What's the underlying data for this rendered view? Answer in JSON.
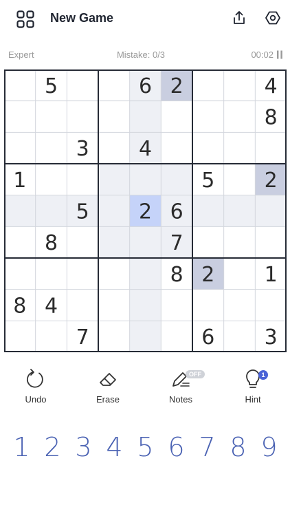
{
  "header": {
    "title": "New Game"
  },
  "status": {
    "difficulty": "Expert",
    "mistakes": "Mistake: 0/3",
    "timer": "00:02"
  },
  "board": {
    "cells": [
      [
        0,
        5,
        0,
        0,
        6,
        2,
        0,
        0,
        4
      ],
      [
        0,
        0,
        0,
        0,
        0,
        0,
        0,
        0,
        8
      ],
      [
        0,
        0,
        3,
        0,
        4,
        0,
        0,
        0,
        0
      ],
      [
        1,
        0,
        0,
        0,
        0,
        0,
        5,
        0,
        2
      ],
      [
        0,
        0,
        5,
        0,
        2,
        6,
        0,
        0,
        0
      ],
      [
        0,
        8,
        0,
        0,
        0,
        7,
        0,
        0,
        0
      ],
      [
        0,
        0,
        0,
        0,
        0,
        8,
        2,
        0,
        1
      ],
      [
        8,
        4,
        0,
        0,
        0,
        0,
        0,
        0,
        0
      ],
      [
        0,
        0,
        7,
        0,
        0,
        0,
        6,
        0,
        3
      ]
    ],
    "selected": {
      "row": 4,
      "col": 4
    },
    "colors": {
      "highlight": "#eef0f5",
      "same_number": "#c9cee0",
      "selected": "#c5d3f9",
      "thick_line": "#262b36",
      "thin_line": "#d3d6dd"
    }
  },
  "toolbar": {
    "undo_label": "Undo",
    "erase_label": "Erase",
    "notes_label": "Notes",
    "notes_state": "OFF",
    "hint_label": "Hint",
    "hint_count": "1"
  },
  "numpad": {
    "numbers": [
      "1",
      "2",
      "3",
      "4",
      "5",
      "6",
      "7",
      "8",
      "9"
    ]
  }
}
